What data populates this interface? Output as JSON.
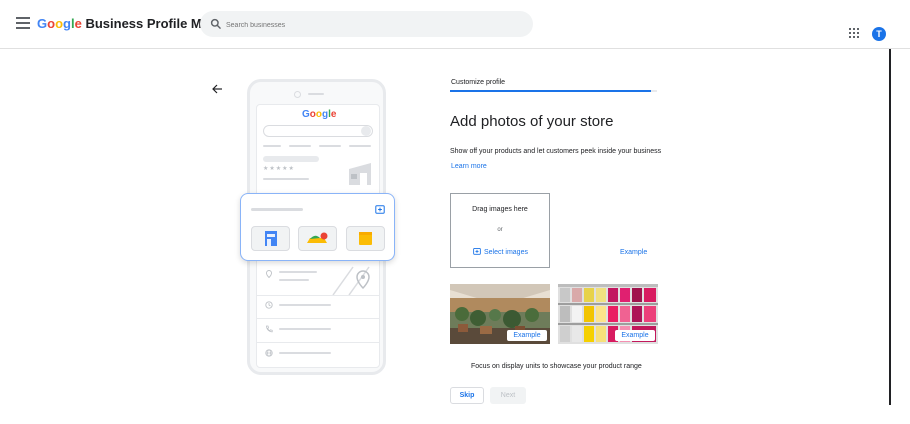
{
  "header": {
    "menu_icon": "menu-icon",
    "brand": {
      "g1": "G",
      "o1": "o",
      "o2": "o",
      "g2": "g",
      "l": "l",
      "e": "e",
      "rest": " Business Profile Manager"
    },
    "search": {
      "placeholder": "Search businesses",
      "icon": "search-icon"
    },
    "apps_icon": "apps-grid-icon",
    "avatar_initial": "T"
  },
  "illustration": {
    "phone_logo": {
      "g1": "G",
      "o1": "o",
      "o2": "o",
      "g2": "g",
      "l": "l",
      "e": "e"
    },
    "stars": "★★★★★"
  },
  "main": {
    "step_label": "Customize profile",
    "progress": 0.97,
    "heading": "Add photos of your store",
    "description": "Show off your products and let customers peek inside your business",
    "learn_more": "Learn more",
    "dropzone": {
      "title": "Drag images here",
      "or": "or",
      "select_label": "Select images"
    },
    "example_link": "Example",
    "photos": [
      {
        "label": "Example",
        "subject": "store-interior-plants"
      },
      {
        "label": "Example",
        "subject": "colorful-shelves"
      }
    ],
    "caption": "Focus on display units to showcase your product range",
    "skip_label": "Skip",
    "next_label": "Next"
  },
  "colors": {
    "accent": "#1a73e8",
    "text": "#202124",
    "muted": "#5f6368"
  }
}
